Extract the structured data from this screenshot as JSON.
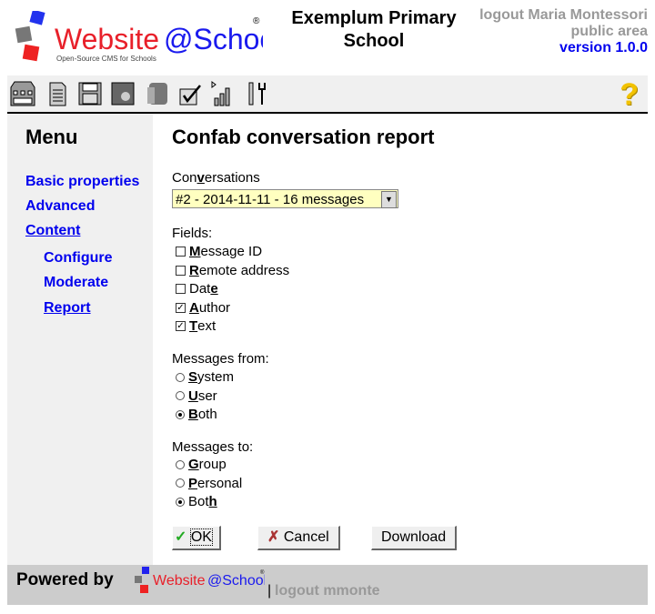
{
  "header": {
    "logo_text": "Website@School",
    "logo_tagline": "Open-Source CMS for Schools",
    "site_title": "Exemplum Primary School",
    "user_line": "logout Maria Montessori",
    "area": "public area",
    "version": "version 1.0.0"
  },
  "toolbar": {
    "icons": [
      "startcenter-icon",
      "pagemanager-icon",
      "filemanager-icon",
      "modules-icon",
      "accountmanager-icon",
      "configurationmanager-icon",
      "statistics-icon",
      "tools-icon"
    ],
    "help": "?"
  },
  "sidebar": {
    "title": "Menu",
    "items": [
      {
        "label": "Basic properties"
      },
      {
        "label": "Advanced"
      },
      {
        "label": "Content"
      },
      {
        "label": "Configure"
      },
      {
        "label": "Moderate"
      },
      {
        "label": "Report"
      }
    ]
  },
  "main": {
    "title": "Confab conversation report",
    "conversations": {
      "pre": "Con",
      "key": "v",
      "post": "ersations",
      "value": "#2 - 2014-11-11 - 16 messages"
    },
    "fields_label": "Fields:",
    "fields": [
      {
        "pre": "",
        "key": "M",
        "post": "essage ID",
        "checked": false
      },
      {
        "pre": "",
        "key": "R",
        "post": "emote address",
        "checked": false
      },
      {
        "pre": "Dat",
        "key": "e",
        "post": "",
        "checked": false
      },
      {
        "pre": "",
        "key": "A",
        "post": "uthor",
        "checked": true
      },
      {
        "pre": "",
        "key": "T",
        "post": "ext",
        "checked": true
      }
    ],
    "from_label": "Messages from:",
    "from": [
      {
        "pre": "",
        "key": "S",
        "post": "ystem",
        "selected": false
      },
      {
        "pre": "",
        "key": "U",
        "post": "ser",
        "selected": false
      },
      {
        "pre": "",
        "key": "B",
        "post": "oth",
        "selected": true
      }
    ],
    "to_label": "Messages to:",
    "to": [
      {
        "pre": "",
        "key": "G",
        "post": "roup",
        "selected": false
      },
      {
        "pre": "",
        "key": "P",
        "post": "ersonal",
        "selected": false
      },
      {
        "pre": "Bot",
        "key": "h",
        "post": "",
        "selected": true
      }
    ],
    "ok": "OK",
    "cancel": "Cancel",
    "download": "Download"
  },
  "footer": {
    "powered": "Powered by",
    "logo_text": "Website@School",
    "sep": "|",
    "logout": "logout mmonte"
  }
}
